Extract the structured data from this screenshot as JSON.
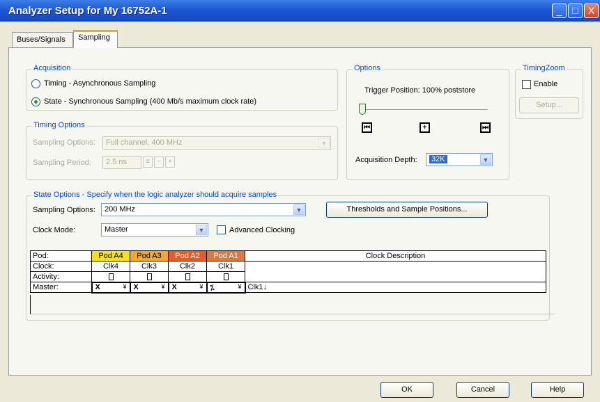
{
  "window": {
    "title": "Analyzer Setup for My 16752A-1",
    "controls": [
      "_",
      "□",
      "X"
    ]
  },
  "tabs": [
    {
      "label": "Buses/Signals",
      "active": false
    },
    {
      "label": "Sampling",
      "active": true
    }
  ],
  "acquisition": {
    "label": "Acquisition",
    "timing_label": "Timing - Asynchronous Sampling",
    "state_label": "State - Synchronous Sampling (400 Mb/s maximum clock rate)",
    "selected": "state"
  },
  "timing_options": {
    "label": "Timing Options",
    "sampling_options_label": "Sampling Options:",
    "sampling_options_value": "Full channel, 400 MHz",
    "sampling_period_label": "Sampling Period:",
    "sampling_period_value": "2.5 ns"
  },
  "options": {
    "label": "Options",
    "trigger_position": "Trigger Position: 100% poststore",
    "acquisition_depth_label": "Acquisition Depth:",
    "acquisition_depth_value": "32K"
  },
  "timing_zoom": {
    "label": "TimingZoom",
    "enable_label": "Enable",
    "setup_label": "Setup..."
  },
  "state_options": {
    "label": "State Options - Specify when the logic analyzer should acquire samples",
    "sampling_options_label": "Sampling Options:",
    "sampling_options_value": "200 MHz",
    "clock_mode_label": "Clock Mode:",
    "clock_mode_value": "Master",
    "advanced_clocking_label": "Advanced Clocking",
    "thresholds_label": "Thresholds and Sample Positions..."
  },
  "pods": {
    "row_labels": [
      "Pod:",
      "Clock:",
      "Activity:",
      "Master:"
    ],
    "clock_description_label": "Clock Description",
    "columns": [
      {
        "name": "Pod A4",
        "clock": "Clk4",
        "master": "X",
        "color": "#f5e020"
      },
      {
        "name": "Pod A3",
        "clock": "Clk3",
        "master": "X",
        "color": "#f0a830"
      },
      {
        "name": "Pod A2",
        "clock": "Clk2",
        "master": "X",
        "color": "#e85a2a"
      },
      {
        "name": "Pod A1",
        "clock": "Clk1",
        "master": "⁒",
        "color": "#d87a40"
      }
    ],
    "clock_description_value": "Clk1↓"
  },
  "footer": {
    "ok_label": "OK",
    "cancel_label": "Cancel",
    "help_label": "Help"
  },
  "colors": {
    "title_bar": "#1e58d4",
    "group_label": "#0046d5",
    "selection": "#316ac5"
  }
}
